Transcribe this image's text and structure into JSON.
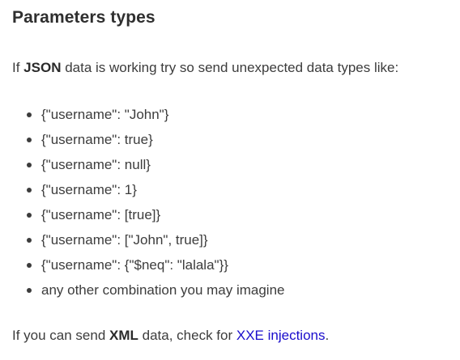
{
  "section": {
    "title": "Parameters types"
  },
  "intro": {
    "prefix": "If ",
    "emphasis": "JSON",
    "suffix": " data is working try so send unexpected data types like:"
  },
  "examples": [
    "{\"username\": \"John\"}",
    "{\"username\": true}",
    "{\"username\": null}",
    "{\"username\": 1}",
    "{\"username\": [true]}",
    "{\"username\": [\"John\", true]}",
    "{\"username\": {\"$neq\": \"lalala\"}}",
    "any other combination you may imagine"
  ],
  "outro": {
    "prefix": "If you can send ",
    "emphasis": "XML",
    "middle": " data, check for ",
    "link_text": "XXE injections",
    "suffix": "."
  },
  "colors": {
    "text": "#3c3c3c",
    "link": "#1a0dcc"
  }
}
